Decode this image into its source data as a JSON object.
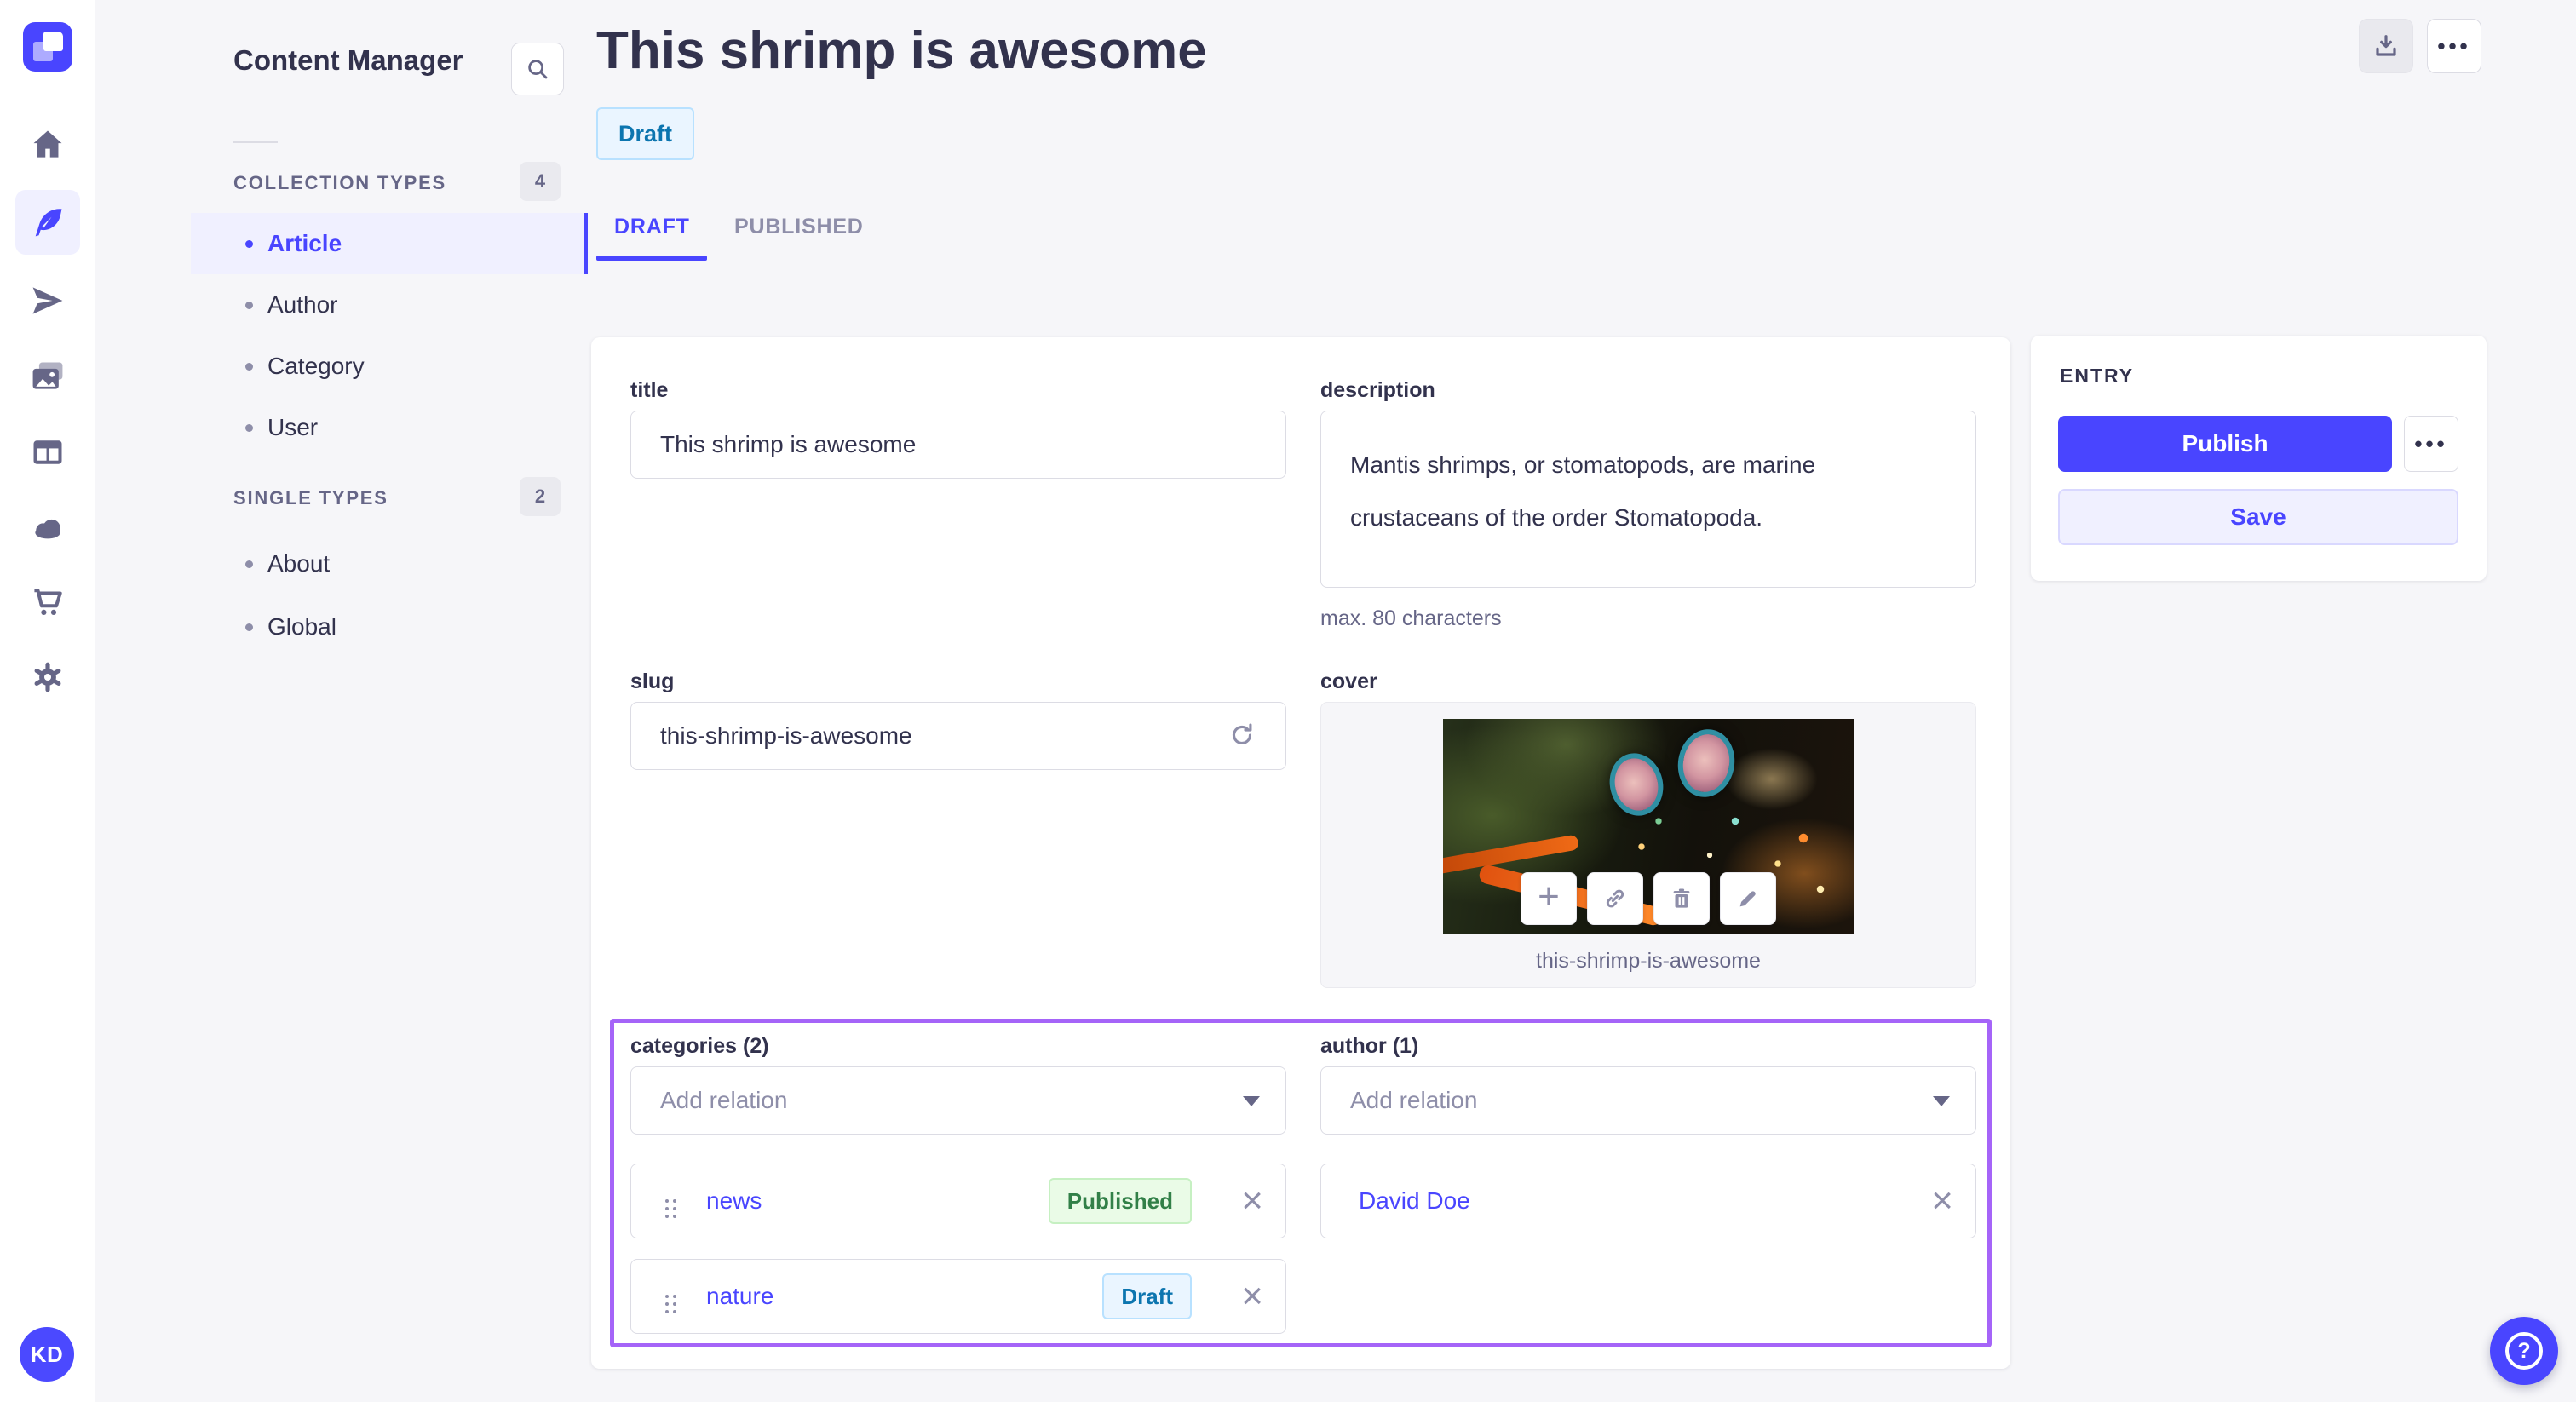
{
  "colors": {
    "accent": "#4945ff",
    "selected_outline": "#a564f8",
    "background": "#f6f6f9",
    "text_dark": "#32324d",
    "text_gray": "#666687",
    "border": "#dcdce4",
    "draft_bg": "#eaf5ff",
    "draft_text": "#0c75af",
    "draft_border": "#b8e1ff",
    "published_bg": "#eafbe7",
    "published_text": "#328048",
    "published_border": "#c6f0c2"
  },
  "rail": {
    "user_initials": "KD",
    "icons": [
      "home",
      "content-manager",
      "releases",
      "media-library",
      "content-type-builder",
      "deploy",
      "marketplace",
      "settings"
    ],
    "active_icon": "content-manager"
  },
  "sidebar": {
    "title": "Content Manager",
    "sections": [
      {
        "label": "COLLECTION TYPES",
        "count": "4",
        "items": [
          {
            "label": "Article"
          },
          {
            "label": "Author"
          },
          {
            "label": "Category"
          },
          {
            "label": "User"
          }
        ],
        "active_item": "Article"
      },
      {
        "label": "SINGLE TYPES",
        "count": "2",
        "items": [
          {
            "label": "About"
          },
          {
            "label": "Global"
          }
        ]
      }
    ]
  },
  "header": {
    "title": "This shrimp is awesome",
    "status": "Draft",
    "tabs": [
      {
        "label": "DRAFT"
      },
      {
        "label": "PUBLISHED"
      }
    ],
    "active_tab": "DRAFT"
  },
  "form": {
    "title": {
      "label": "title",
      "value": "This shrimp is awesome"
    },
    "description": {
      "label": "description",
      "value": "Mantis shrimps, or stomatopods, are marine crustaceans of the order Stomatopoda.",
      "helper": "max. 80 characters"
    },
    "slug": {
      "label": "slug",
      "value": "this-shrimp-is-awesome"
    },
    "cover": {
      "label": "cover",
      "filename": "this-shrimp-is-awesome"
    },
    "categories": {
      "label": "categories (2)",
      "placeholder": "Add relation",
      "relations": [
        {
          "name": "news",
          "status": "Published"
        },
        {
          "name": "nature",
          "status": "Draft"
        }
      ]
    },
    "author": {
      "label": "author (1)",
      "placeholder": "Add relation",
      "relations": [
        {
          "name": "David Doe"
        }
      ]
    }
  },
  "entry_panel": {
    "title": "ENTRY",
    "publish": "Publish",
    "save": "Save"
  },
  "icons": {
    "more": "•••",
    "plus": "+",
    "close": "×",
    "help": "?"
  }
}
